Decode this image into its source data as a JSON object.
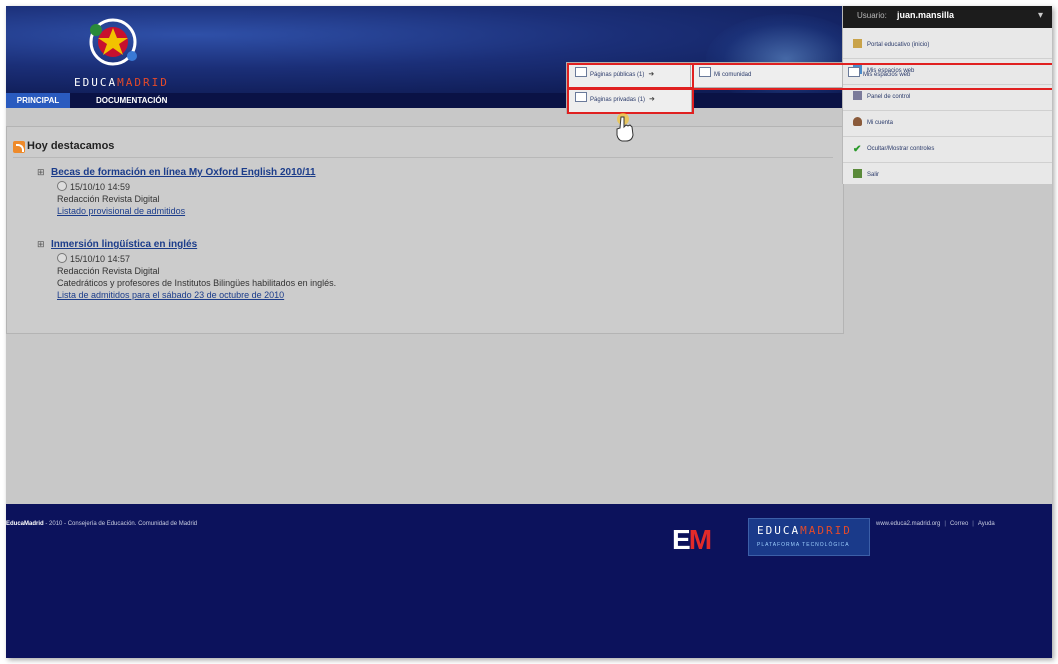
{
  "header": {
    "logo_text_a": "EDUCA",
    "logo_text_b": "MADRID",
    "nav": [
      "PRINCIPAL",
      "DOCUMENTACIÓN"
    ]
  },
  "menus": {
    "paginas_publicas": "Páginas públicas (1)",
    "paginas_privadas": "Páginas privadas (1)",
    "mi_comunidad": "Mi comunidad",
    "mis_espacios_web": "Mis espacios web"
  },
  "user_panel": {
    "label": "Usuario:",
    "username": "juan.mansilla",
    "items": [
      {
        "label": "Portal educativo (inicio)",
        "icon": "home-icon"
      },
      {
        "label": "Mis espacios web",
        "icon": "web-spaces-icon"
      },
      {
        "label": "Panel de control",
        "icon": "control-panel-icon"
      },
      {
        "label": "Mi cuenta",
        "icon": "user-icon"
      },
      {
        "label": "Ocultar/Mostrar controles",
        "icon": "checkmark-icon"
      },
      {
        "label": "Salir",
        "icon": "exit-icon"
      }
    ]
  },
  "main": {
    "section_title": "Hoy destacamos",
    "news": [
      {
        "title": "Becas de formación en línea My Oxford English 2010/11",
        "date": "15/10/10 14:59",
        "author": "Redacción Revista Digital",
        "description": "",
        "link": "Listado provisional de admitidos"
      },
      {
        "title": "Inmersión lingüística en inglés",
        "date": "15/10/10 14:57",
        "author": "Redacción Revista Digital",
        "description": "Catedráticos y profesores de Institutos Bilingües habilitados en inglés.",
        "link": "Lista de admitidos para el sábado 23 de octubre de 2010"
      }
    ]
  },
  "footer": {
    "brand": "EducaMadrid",
    "text": " - 2010 - Consejería de Educación. Comunidad de Madrid",
    "em_logo_a": "E",
    "em_logo_b": "M",
    "edu_title_a": "EDUCA",
    "edu_title_b": "MADRID",
    "edu_sub": "PLATAFORMA TECNOLÓGICA",
    "links": [
      "www.educa2.madrid.org",
      "Correo",
      "Ayuda"
    ]
  },
  "colors": {
    "header_bg": "#10205a",
    "nav_active": "#2a5bbf",
    "footer_bg": "#0c125c",
    "highlight": "#e02020",
    "link": "#1b3c8a"
  }
}
